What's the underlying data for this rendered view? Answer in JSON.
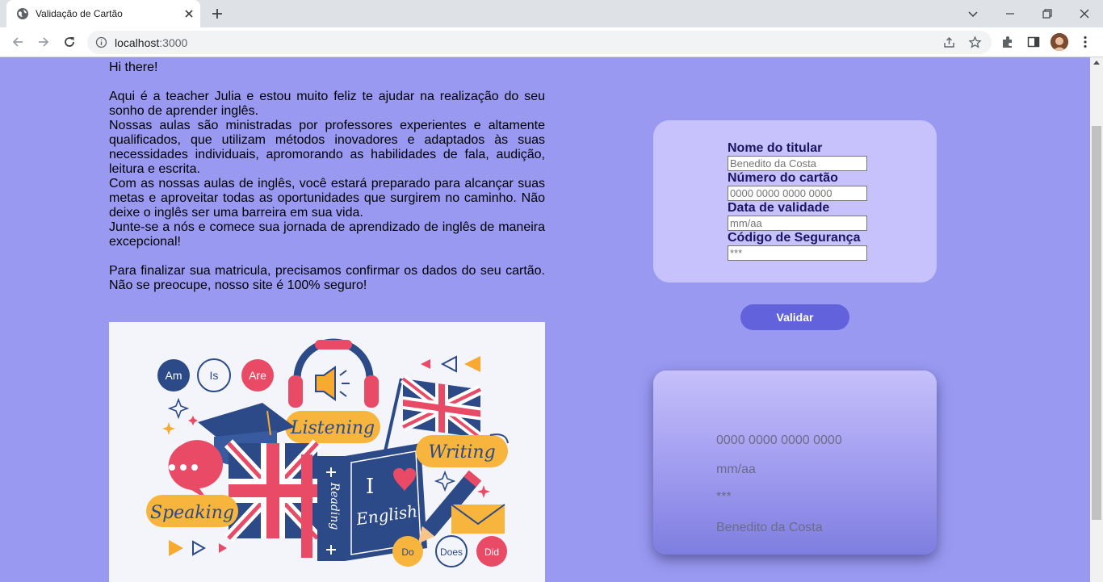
{
  "browser": {
    "tab_title": "Validação de Cartão",
    "url_host": "localhost",
    "url_port": ":3000"
  },
  "intro": {
    "greeting": "Hi there!",
    "paragraph_1": "Aqui é a teacher Julia e estou muito feliz te ajudar na realização do seu sonho de aprender inglês.",
    "paragraph_2": "Nossas aulas são ministradas por professores experientes e altamente qualificados, que utilizam métodos inovadores e adaptados às suas necessidades individuais, apromorando as habilidades de fala, audição, leitura e escrita.",
    "paragraph_3": "Com as nossas aulas de inglês, você estará preparado para alcançar suas metas e aproveitar todas as oportunidades que surgirem no caminho. Não deixe o inglês ser uma barreira em sua vida.",
    "paragraph_4": "Junte-se a nós e comece sua jornada de aprendizado de inglês de maneira excepcional!",
    "paragraph_5": "Para finalizar sua matricula, precisamos confirmar os dados do seu cartão. Não se preocupe, nosso site é 100% seguro!"
  },
  "illustration": {
    "bubbles": [
      "Am",
      "Is",
      "Are",
      "Do",
      "Does",
      "Did"
    ],
    "listening": "Listening",
    "writing": "Writing",
    "speaking": "Speaking",
    "reading": "Reading",
    "book_i": "I",
    "book_english": "English"
  },
  "form": {
    "holder_label": "Nome do titular",
    "holder_placeholder": "Benedito da Costa",
    "number_label": "Número do cartão",
    "number_placeholder": "0000 0000 0000 0000",
    "expiry_label": "Data de validade",
    "expiry_placeholder": "mm/aa",
    "cvv_label": "Código de Segurança",
    "cvv_placeholder": "***",
    "validate_label": "Validar"
  },
  "card_preview": {
    "number": "0000 0000 0000 0000",
    "expiry": "mm/aa",
    "cvv": "***",
    "holder": "Benedito da Costa"
  },
  "colors": {
    "page_background": "#9999f2",
    "form_panel": "#c7c2fb",
    "label_text": "#1b1464",
    "button": "#6262dc"
  }
}
